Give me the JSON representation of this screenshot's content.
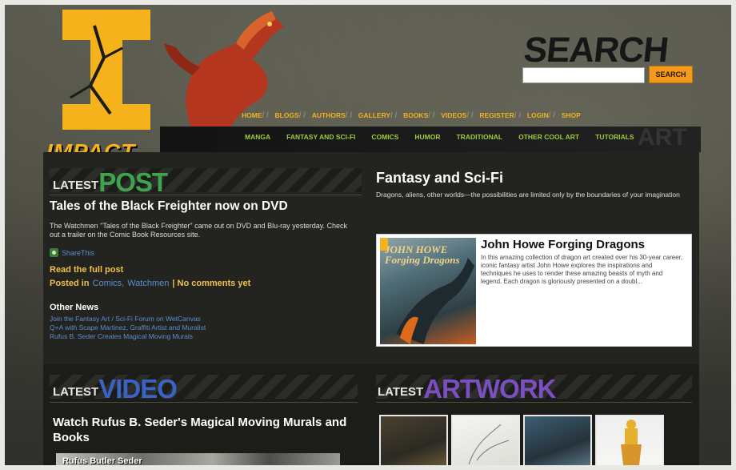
{
  "header": {
    "logo_text": "IMPACT",
    "search_title": "SEARCH",
    "search_value": "",
    "search_button": "SEARCH"
  },
  "nav_main": [
    {
      "label": "HOME"
    },
    {
      "label": "BLOGS"
    },
    {
      "label": "AUTHORS"
    },
    {
      "label": "GALLERY"
    },
    {
      "label": "BOOKS"
    },
    {
      "label": "VIDEOS"
    },
    {
      "label": "REGISTER"
    },
    {
      "label": "LOGIN"
    },
    {
      "label": "SHOP"
    }
  ],
  "nav_sub": [
    {
      "label": "MANGA"
    },
    {
      "label": "FANTASY AND SCI-FI"
    },
    {
      "label": "COMICS"
    },
    {
      "label": "HUMOR"
    },
    {
      "label": "TRADITIONAL"
    },
    {
      "label": "OTHER COOL ART"
    },
    {
      "label": "TUTORIALS"
    }
  ],
  "nav_bg_word": "ART",
  "latest_post": {
    "head_small": "LATEST",
    "head_big": "POST",
    "title": "Tales of the Black Freighter now on DVD",
    "body": "The Watchmen \"Tales of the Black Freighter\" came out on DVD and Blu-ray yesterday. Check out a trailer on the Comic Book Resources site.",
    "share": "ShareThis",
    "read_more": "Read the full post",
    "posted_in_label": "Posted in",
    "posted_in_links": [
      "Comics,",
      "Watchmen"
    ],
    "comments": "| No comments yet",
    "other_news_heading": "Other News",
    "other_news": [
      "Join the Fantasy Art / Sci-Fi Forum on WetCanvas",
      "Q+A with Scape Martinez, Graffiti Artist and Muralist",
      "Rufus B. Seder Creates Magical Moving Murals"
    ]
  },
  "category": {
    "title": "Fantasy and Sci-Fi",
    "description": "Dragons, aliens, other worlds—the possibilities are limited only by the boundaries of your imagination",
    "book_cover_text": "JOHN HOWE Forging Dragons",
    "book_title": "John Howe Forging Dragons",
    "book_desc": "In this amazing collection of dragon art created over his 30-year career, iconic fantasy artist John Howe explores the inspirations and techniques he uses to render these amazing beasts of myth and legend. Each dragon is gloriously presented on a doubl..."
  },
  "latest_video": {
    "head_small": "LATEST",
    "head_big": "VIDEO",
    "title": "Watch Rufus B. Seder's Magical Moving Murals and Books",
    "thumb_label": "Rufus Butler Seder"
  },
  "latest_artwork": {
    "head_small": "LATEST",
    "head_big": "ARTWORK",
    "thumbs": [
      "artwork-1",
      "artwork-2",
      "artwork-3",
      "artwork-4"
    ]
  },
  "colors": {
    "logo": "#f5b21b",
    "post_head": "#3fa34d",
    "video_head": "#3a63c4",
    "artwork_head": "#7b4fc1",
    "link": "#5b8fd0",
    "read_more": "#f0c24a",
    "search_button": "#f39a1a"
  }
}
